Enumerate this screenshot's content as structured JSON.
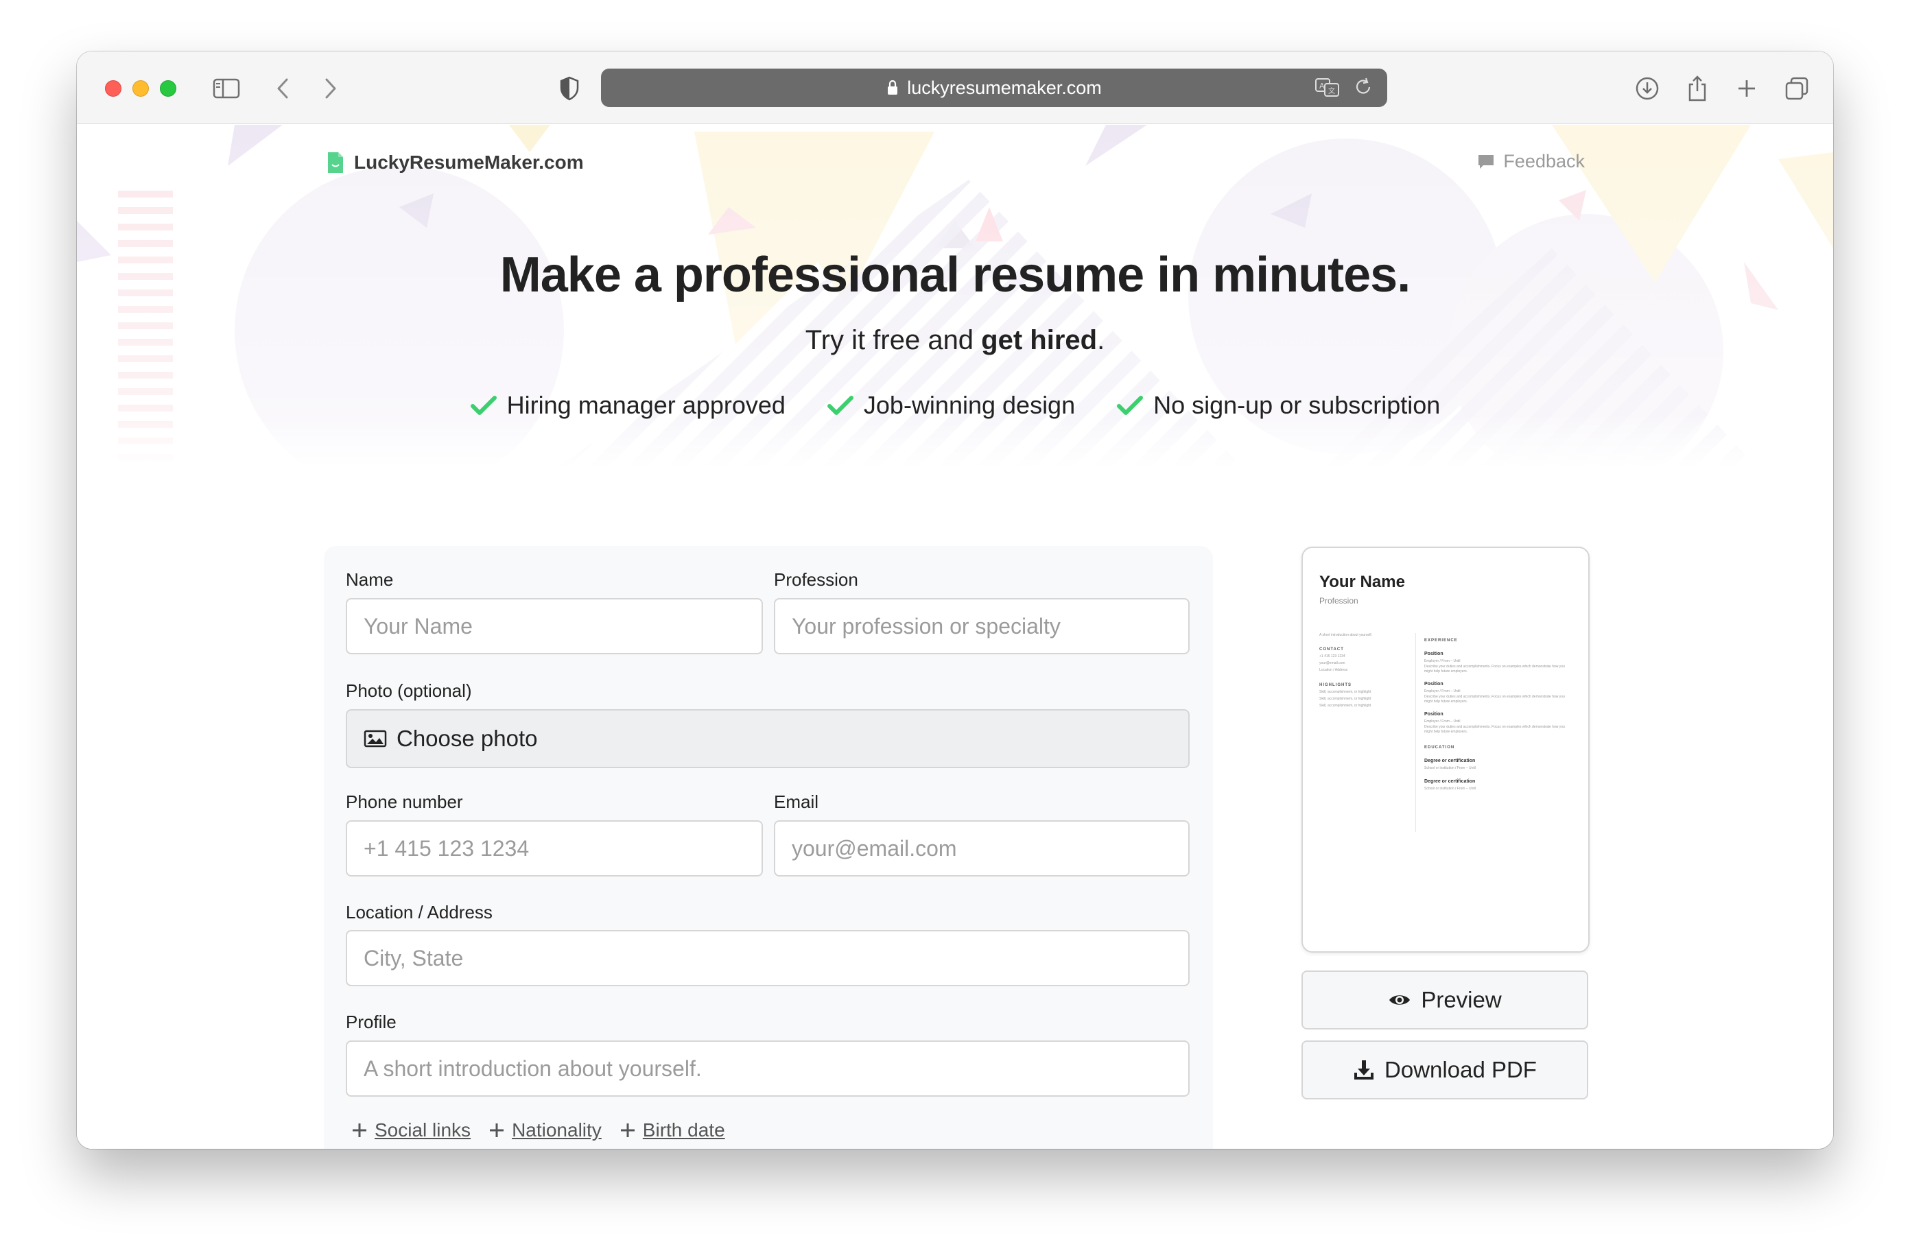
{
  "browser": {
    "url": "luckyresumemaker.com"
  },
  "header": {
    "brand": "LuckyResumeMaker.com",
    "feedback": "Feedback"
  },
  "hero": {
    "title": "Make a professional resume in minutes.",
    "subtitle_prefix": "Try it free and ",
    "subtitle_bold": "get hired",
    "subtitle_suffix": ".",
    "features": [
      "Hiring manager approved",
      "Job-winning design",
      "No sign-up or subscription"
    ]
  },
  "form": {
    "name": {
      "label": "Name",
      "placeholder": "Your Name"
    },
    "profession": {
      "label": "Profession",
      "placeholder": "Your profession or specialty"
    },
    "photo": {
      "label": "Photo (optional)",
      "button": "Choose photo"
    },
    "phone": {
      "label": "Phone number",
      "placeholder": "+1 415 123 1234"
    },
    "email": {
      "label": "Email",
      "placeholder": "your@email.com"
    },
    "location": {
      "label": "Location / Address",
      "placeholder": "City, State"
    },
    "profile": {
      "label": "Profile",
      "placeholder": "A short introduction about yourself."
    },
    "extra_links": [
      "Social links",
      "Nationality",
      "Birth date"
    ]
  },
  "preview": {
    "name": "Your Name",
    "profession": "Profession",
    "intro": "A short introduction about yourself.",
    "contact_heading": "CONTACT",
    "contact": [
      "+1 415 123 1234",
      "your@email.com",
      "Location / Address"
    ],
    "highlights_heading": "HIGHLIGHTS",
    "highlights": [
      "Skill, accomplishment, or highlight",
      "Skill, accomplishment, or highlight",
      "Skill, accomplishment, or highlight"
    ],
    "experience_heading": "EXPERIENCE",
    "position": "Position",
    "employer": "Employer / From – Until",
    "duties": "Describe your duties and accomplishments. Focus on examples which demonstrate how you might help future employers.",
    "education_heading": "EDUCATION",
    "degree": "Degree or certification",
    "school": "School or institution / From – Until"
  },
  "actions": {
    "preview": "Preview",
    "download": "Download PDF"
  },
  "colors": {
    "accent_check": "#3ccf6e",
    "brand_icon": "#56d38c"
  }
}
